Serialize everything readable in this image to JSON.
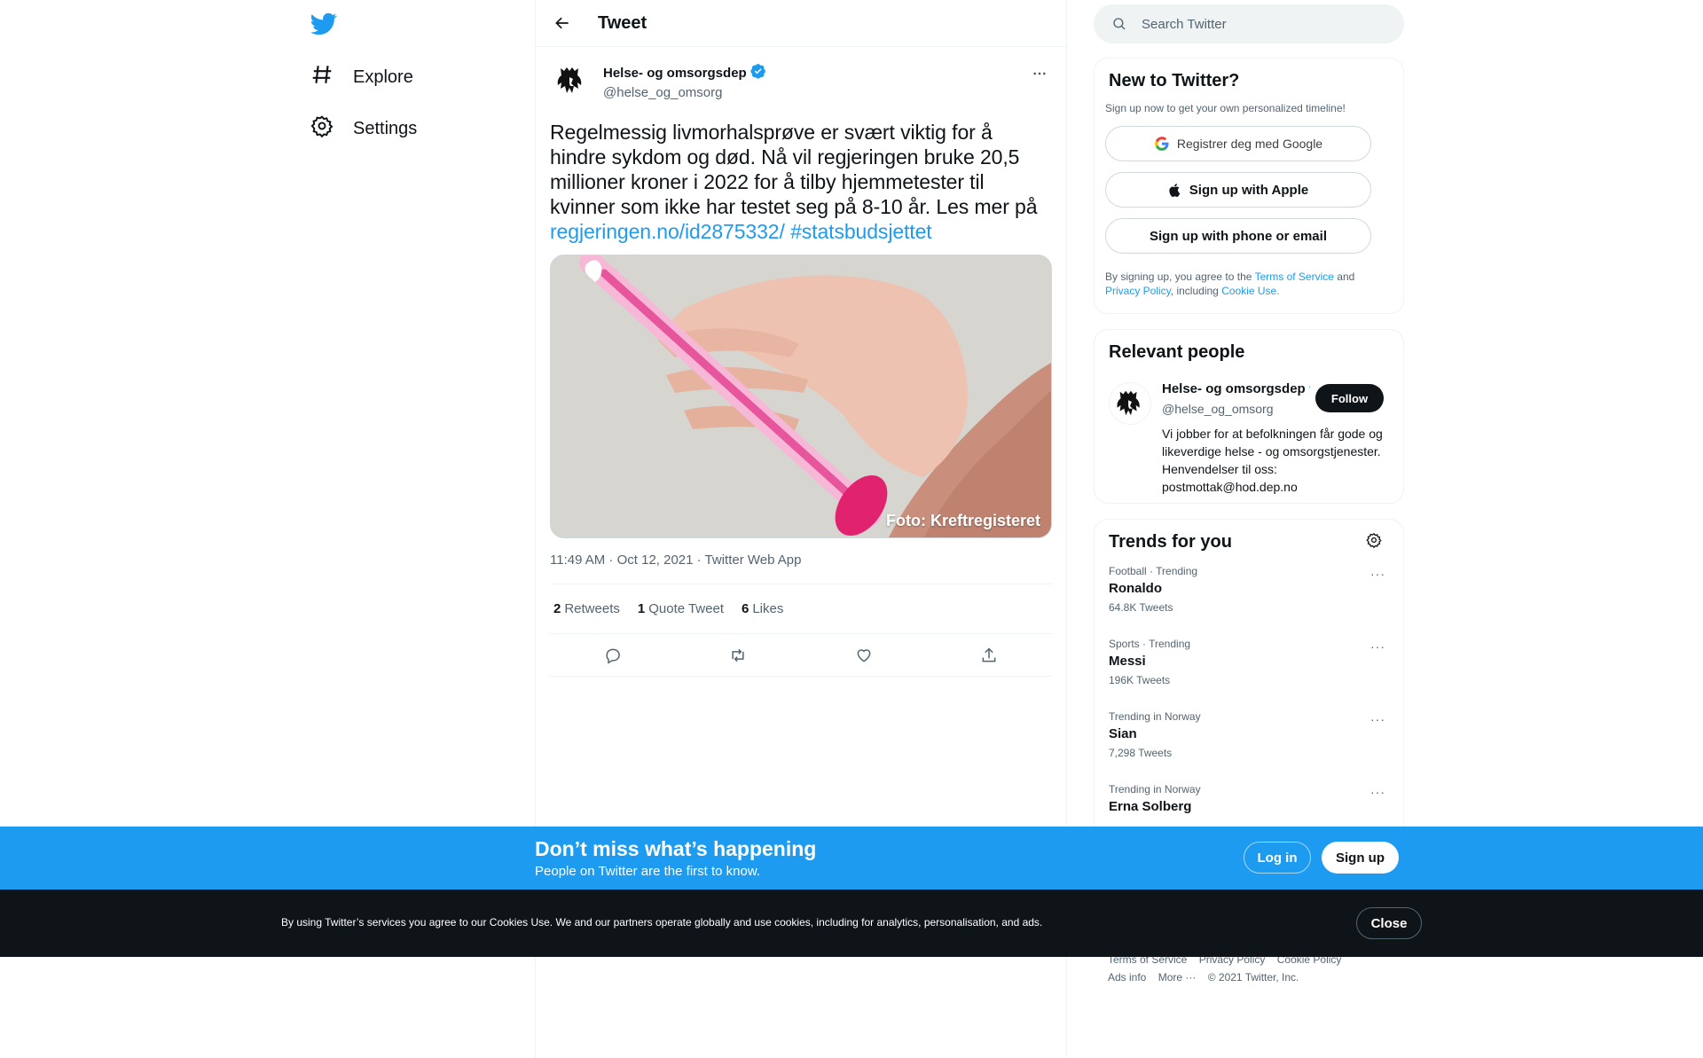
{
  "nav": {
    "explore_label": "Explore",
    "settings_label": "Settings"
  },
  "header": {
    "title": "Tweet"
  },
  "tweet": {
    "author_name": "Helse- og omsorgsdep",
    "author_handle": "@helse_og_omsorg",
    "text_main": "Regelmessig livmorhalsprøve er svært viktig for å hindre sykdom og død. Nå vil regjeringen bruke 20,5 millioner kroner i 2022 for å tilby hjemmetester til kvinner som ikke har testet seg på 8-10 år. Les mer på",
    "link_text": "regjeringen.no/id2875332/",
    "hashtag_text": "#statsbudsjettet",
    "photo_credit": "Foto: Kreftregisteret",
    "meta": "11:49 AM · Oct 12, 2021 · Twitter Web App",
    "stats": {
      "retweets_count": "2",
      "retweets_label": "Retweets",
      "quotes_count": "1",
      "quotes_label": "Quote Tweet",
      "likes_count": "6",
      "likes_label": "Likes"
    }
  },
  "search": {
    "placeholder": "Search Twitter"
  },
  "new_to_twitter": {
    "title": "New to Twitter?",
    "subtitle": "Sign up now to get your own personalized timeline!",
    "google_label": "Registrer deg med Google",
    "apple_label": "Sign up with Apple",
    "phone_label": "Sign up with phone or email",
    "terms_prefix": "By signing up, you agree to the",
    "terms_link": "Terms of Service",
    "terms_and": "and",
    "privacy_link": "Privacy Policy",
    "including": ", including",
    "cookie_link": "Cookie Use."
  },
  "relevant": {
    "title": "Relevant people",
    "name": "Helse- og omsorgsdep",
    "handle": "@helse_og_omsorg",
    "follow_label": "Follow",
    "bio": "Vi jobber for at befolkningen får gode og likeverdige helse - og omsorgstjenester. Henvendelser til oss: postmottak@hod.dep.no"
  },
  "trends": {
    "title": "Trends for you",
    "items": [
      {
        "meta": "Football · Trending",
        "name": "Ronaldo",
        "count": "64.8K Tweets"
      },
      {
        "meta": "Sports · Trending",
        "name": "Messi",
        "count": "196K Tweets"
      },
      {
        "meta": "Trending in Norway",
        "name": "Sian",
        "count": "7,298 Tweets"
      },
      {
        "meta": "Trending in Norway",
        "name": "Erna Solberg",
        "count": ""
      }
    ]
  },
  "footer": {
    "terms": "Terms of Service",
    "privacy": "Privacy Policy",
    "cookie": "Cookie Policy",
    "ads": "Ads info",
    "more": "More ···",
    "copyright": "© 2021 Twitter, Inc."
  },
  "signup_bar": {
    "title": "Don’t miss what’s happening",
    "subtitle": "People on Twitter are the first to know.",
    "login_label": "Log in",
    "signup_label": "Sign up"
  },
  "cookie_bar": {
    "text": "By using Twitter’s services you agree to our Cookies Use. We and our partners operate globally and use cookies, including for analytics, personalisation, and ads.",
    "close_label": "Close"
  },
  "colors": {
    "accent": "#1d9bf0",
    "text_primary": "#0f1419",
    "text_secondary": "#536471",
    "cookie_bg": "#0f1419"
  }
}
